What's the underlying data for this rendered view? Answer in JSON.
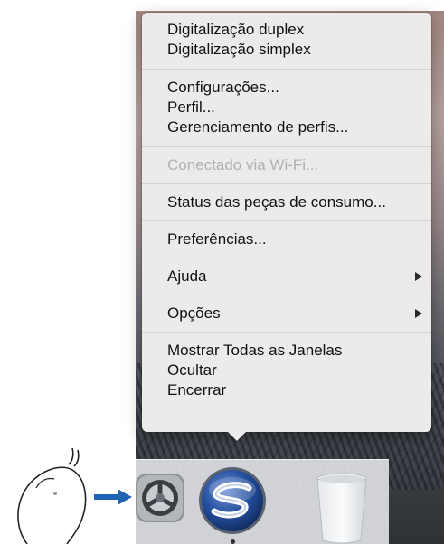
{
  "menu": {
    "groups": [
      [
        {
          "label": "Digitalização duplex",
          "enabled": true
        },
        {
          "label": "Digitalização simplex",
          "enabled": true
        }
      ],
      [
        {
          "label": "Configurações...",
          "enabled": true
        },
        {
          "label": "Perfil...",
          "enabled": true
        },
        {
          "label": "Gerenciamento de perfis...",
          "enabled": true
        }
      ],
      [
        {
          "label": "Conectado via Wi-Fi...",
          "enabled": false
        }
      ],
      [
        {
          "label": "Status das peças de consumo...",
          "enabled": true
        }
      ],
      [
        {
          "label": "Preferências...",
          "enabled": true
        }
      ],
      [
        {
          "label": "Ajuda",
          "enabled": true,
          "submenu": true
        }
      ],
      [
        {
          "label": "Opções",
          "enabled": true,
          "submenu": true
        }
      ],
      [
        {
          "label": "Mostrar Todas as Janelas",
          "enabled": true
        },
        {
          "label": "Ocultar",
          "enabled": true
        },
        {
          "label": "Encerrar",
          "enabled": true
        }
      ]
    ]
  },
  "dock": {
    "items": [
      {
        "icon": "system-preferences-gear-icon"
      },
      {
        "icon": "scansnap-manager-icon",
        "running": true
      },
      {
        "icon": "trash-icon"
      }
    ]
  },
  "colors": {
    "menu_bg": "#ecebea",
    "disabled_text": "#b1b0b0",
    "arrow_blue": "#1f63b4",
    "scansnap_blue": "#1f4fa0"
  }
}
